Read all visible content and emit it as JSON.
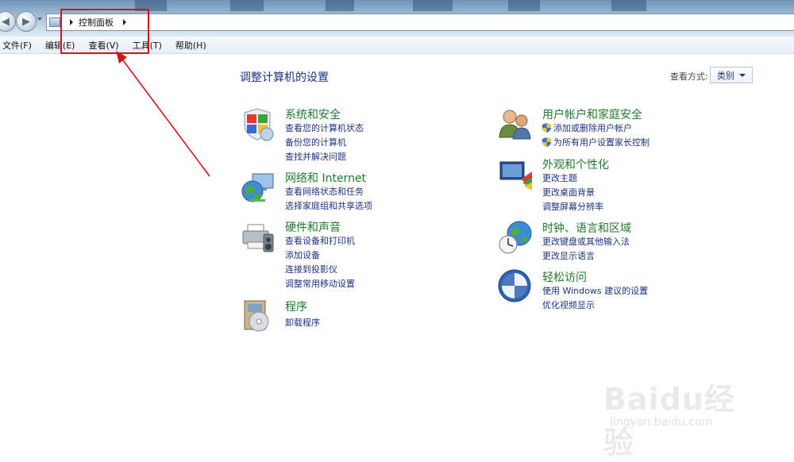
{
  "address": {
    "crumb": "控制面板"
  },
  "menu": [
    "文件(F)",
    "编辑(E)",
    "查看(V)",
    "工具(T)",
    "帮助(H)"
  ],
  "content": {
    "title": "调整计算机的设置",
    "view_by_label": "查看方式:",
    "view_by_value": "类别"
  },
  "categories": {
    "system_security": {
      "title": "系统和安全",
      "links": [
        "查看您的计算机状态",
        "备份您的计算机",
        "查找并解决问题"
      ]
    },
    "network": {
      "title": "网络和 Internet",
      "links": [
        "查看网络状态和任务",
        "选择家庭组和共享选项"
      ]
    },
    "hardware": {
      "title": "硬件和声音",
      "links": [
        "查看设备和打印机",
        "添加设备",
        "连接到投影仪",
        "调整常用移动设置"
      ]
    },
    "programs": {
      "title": "程序",
      "links": [
        "卸载程序"
      ]
    },
    "user_accounts": {
      "title": "用户帐户和家庭安全",
      "links": [
        "添加或删除用户帐户",
        "为所有用户设置家长控制"
      ]
    },
    "appearance": {
      "title": "外观和个性化",
      "links": [
        "更改主题",
        "更改桌面背景",
        "调整屏幕分辨率"
      ]
    },
    "clock": {
      "title": "时钟、语言和区域",
      "links": [
        "更改键盘或其他输入法",
        "更改显示语言"
      ]
    },
    "ease": {
      "title": "轻松访问",
      "links": [
        "使用 Windows 建议的设置",
        "优化视频显示"
      ]
    }
  },
  "watermark": {
    "main": "Baidu经验",
    "sub": "jingyan.baidu.com"
  },
  "colors": {
    "link": "#1e3287",
    "category_title": "#1f7a2c",
    "annotation_red": "#d01818"
  }
}
